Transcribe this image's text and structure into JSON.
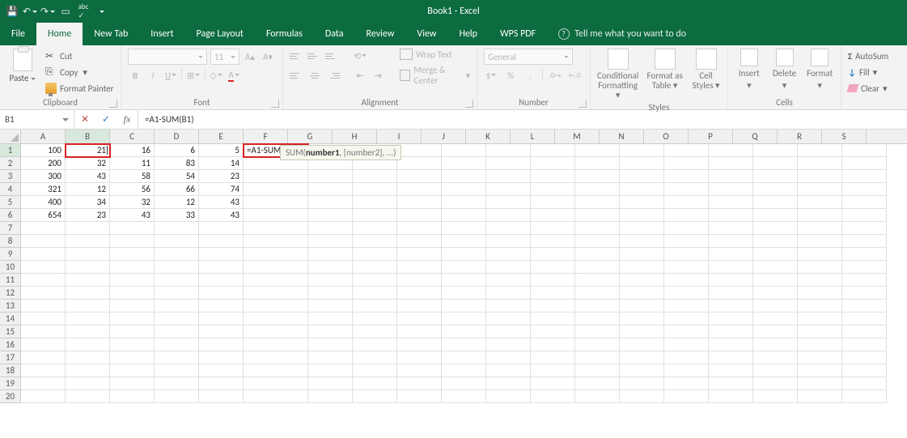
{
  "title": "Book1 - Excel",
  "qat": {
    "save": "save",
    "undo": "undo",
    "redo": "redo",
    "touch": "touch",
    "spell": "spell",
    "more": "more"
  },
  "tabs": [
    "File",
    "Home",
    "New Tab",
    "Insert",
    "Page Layout",
    "Formulas",
    "Data",
    "Review",
    "View",
    "Help",
    "WPS PDF"
  ],
  "activeTab": "Home",
  "tellMe": "Tell me what you want to do",
  "ribbon": {
    "clipboard": {
      "paste": "Paste",
      "cut": "Cut",
      "copy": "Copy",
      "painter": "Format Painter",
      "label": "Clipboard"
    },
    "font": {
      "size": "11",
      "bold": "B",
      "italic": "I",
      "underline": "U",
      "label": "Font"
    },
    "alignment": {
      "wrap": "Wrap Text",
      "merge": "Merge & Center",
      "label": "Alignment"
    },
    "number": {
      "format": "General",
      "label": "Number"
    },
    "styles": {
      "cond": "Conditional Formatting",
      "table": "Format as Table",
      "cell": "Cell Styles",
      "label": "Styles"
    },
    "cells": {
      "insert": "Insert",
      "delete": "Delete",
      "format": "Format",
      "label": "Cells"
    },
    "editing": {
      "autosum": "AutoSum",
      "fill": "Fill",
      "clear": "Clear"
    }
  },
  "nameBox": "B1",
  "formula": "=A1-SUM(B1)",
  "columns": [
    "A",
    "B",
    "C",
    "D",
    "E",
    "F",
    "G",
    "H",
    "I",
    "J",
    "K",
    "L",
    "M",
    "N",
    "O",
    "P",
    "Q",
    "R",
    "S"
  ],
  "rows": [
    1,
    2,
    3,
    4,
    5,
    6,
    7,
    8,
    9,
    10,
    11,
    12,
    13,
    14,
    15,
    16,
    17,
    18,
    19,
    20
  ],
  "activeCol": "B",
  "activeRow": 1,
  "editCellText": "=A1-SUM(B1)",
  "tooltip": {
    "fn": "SUM(",
    "arg1": "number1",
    "rest": ", [number2], ...)"
  },
  "data": {
    "1": {
      "A": "100",
      "B": "21",
      "C": "16",
      "D": "6",
      "E": "5"
    },
    "2": {
      "A": "200",
      "B": "32",
      "C": "11",
      "D": "83",
      "E": "14"
    },
    "3": {
      "A": "300",
      "B": "43",
      "C": "58",
      "D": "54",
      "E": "23"
    },
    "4": {
      "A": "321",
      "B": "12",
      "C": "56",
      "D": "66",
      "E": "74"
    },
    "5": {
      "A": "400",
      "B": "34",
      "C": "32",
      "D": "12",
      "E": "43"
    },
    "6": {
      "A": "654",
      "B": "23",
      "C": "43",
      "D": "33",
      "E": "43"
    }
  }
}
